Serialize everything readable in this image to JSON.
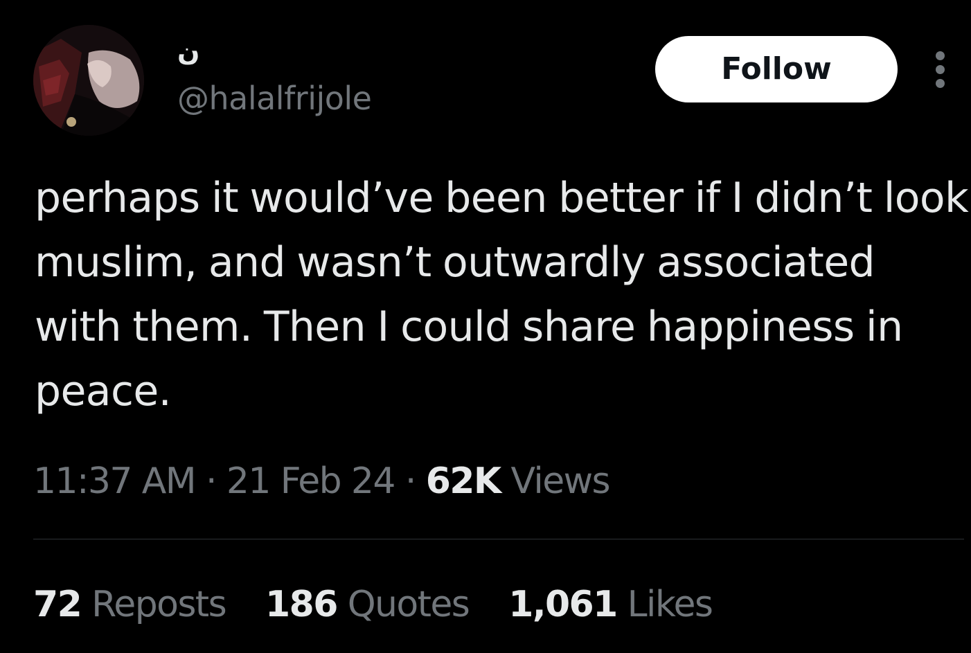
{
  "author": {
    "display_name": "ن",
    "handle": "@halalfrijole",
    "avatar_icon": "avatar-photo"
  },
  "actions": {
    "follow_label": "Follow",
    "more_icon": "more-dots-icon"
  },
  "tweet": {
    "text": "perhaps it would’ve been better if I didn’t look muslim, and wasn’t outwardly associated with them. Then I could share happiness in peace."
  },
  "meta": {
    "time": "11:37 AM",
    "separator": "·",
    "date": "21 Feb 24",
    "views_count": "62K",
    "views_label": "Views"
  },
  "stats": {
    "reposts_count": "72",
    "reposts_label": "Reposts",
    "quotes_count": "186",
    "quotes_label": "Quotes",
    "likes_count": "1,061",
    "likes_label": "Likes"
  },
  "colors": {
    "background": "#000000",
    "primary_text": "#e7e9ea",
    "secondary_text": "#71767b",
    "divider": "#2f3336",
    "follow_bg": "#ffffff",
    "follow_text": "#0f1419"
  }
}
